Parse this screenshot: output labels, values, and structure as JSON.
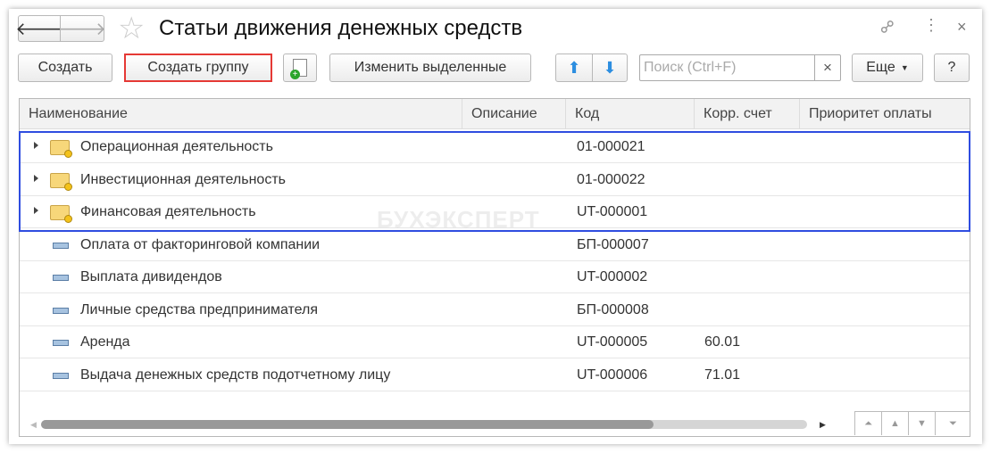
{
  "title": "Статьи движения денежных средств",
  "toolbar": {
    "create": "Создать",
    "create_group": "Создать группу",
    "edit_selected": "Изменить выделенные",
    "search_placeholder": "Поиск (Ctrl+F)",
    "search_clear": "×",
    "more": "Еще",
    "help": "?"
  },
  "columns": [
    "Наименование",
    "Описание",
    "Код",
    "Корр. счет",
    "Приоритет оплаты"
  ],
  "rows": [
    {
      "type": "group",
      "name": "Операционная деятельность",
      "code": "01-000021",
      "account": ""
    },
    {
      "type": "group",
      "name": "Инвестиционная деятельность",
      "code": "01-000022",
      "account": ""
    },
    {
      "type": "group",
      "name": "Финансовая деятельность",
      "code": "UT-000001",
      "account": ""
    },
    {
      "type": "item",
      "name": "Оплата от факторинговой компании",
      "code": "БП-000007",
      "account": ""
    },
    {
      "type": "item",
      "name": "Выплата дивидендов",
      "code": "UT-000002",
      "account": ""
    },
    {
      "type": "item",
      "name": "Личные средства предпринимателя",
      "code": "БП-000008",
      "account": ""
    },
    {
      "type": "item",
      "name": "Аренда",
      "code": "UT-000005",
      "account": "60.01"
    },
    {
      "type": "item",
      "name": "Выдача денежных средств подотчетному лицу",
      "code": "UT-000006",
      "account": "71.01"
    }
  ],
  "watermark": "БУХЭКСПЕРТ",
  "scroll": {
    "horizontal_thumb_fraction": 0.8
  },
  "colors": {
    "highlight_red": "#e53935",
    "highlight_blue": "#2f4de0"
  }
}
